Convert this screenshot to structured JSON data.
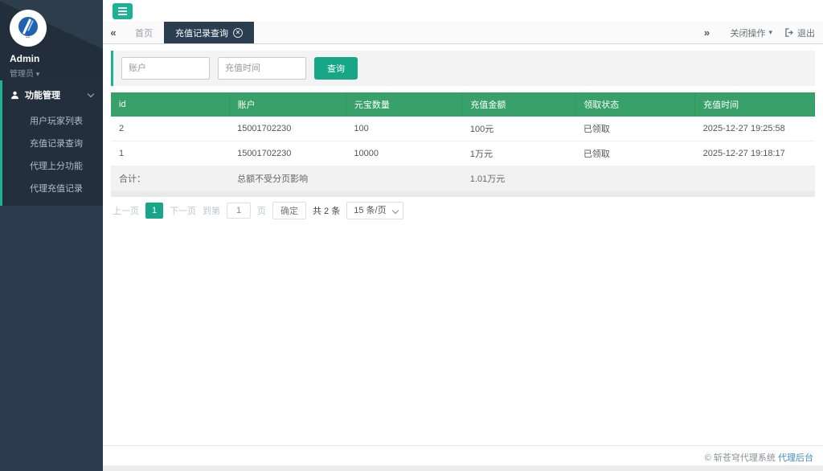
{
  "colors": {
    "teal": "#18a689",
    "header_green": "#38a169",
    "tab_dark": "#2b3e50",
    "status_red": "#e23c33",
    "link_blue": "#3c8dbc"
  },
  "sidebar": {
    "username": "Admin",
    "role": "管理员",
    "menu": {
      "label": "功能管理",
      "items": [
        {
          "label": "用户玩家列表"
        },
        {
          "label": "充值记录查询"
        },
        {
          "label": "代理上分功能"
        },
        {
          "label": "代理充值记录"
        }
      ]
    }
  },
  "tabs": {
    "home": "首页",
    "active": "充值记录查询"
  },
  "topbar": {
    "close_ops": "关闭操作",
    "logout": "退出"
  },
  "search": {
    "account_placeholder": "账户",
    "time_placeholder": "充值时间",
    "query_label": "查询"
  },
  "table": {
    "headers": [
      "id",
      "账户",
      "元宝数量",
      "充值金额",
      "领取状态",
      "充值时间"
    ],
    "rows": [
      [
        "2",
        "15001702230",
        "100",
        "100元",
        "已领取",
        "2025-12-27 19:25:58"
      ],
      [
        "1",
        "15001702230",
        "10000",
        "1万元",
        "已领取",
        "2025-12-27 19:18:17"
      ]
    ],
    "summary": {
      "label": "合计：",
      "note": "总额不受分页影响",
      "amount": "1.01万元"
    }
  },
  "pagination": {
    "prev": "上一页",
    "page": "1",
    "next": "下一页",
    "goto_prefix": "到第",
    "goto_value": "1",
    "goto_suffix": "页",
    "confirm": "确定",
    "total": "共 2 条",
    "page_size": "15 条/页"
  },
  "footer": {
    "copyright": "© 斩苍穹代理系统",
    "link": "代理后台"
  }
}
